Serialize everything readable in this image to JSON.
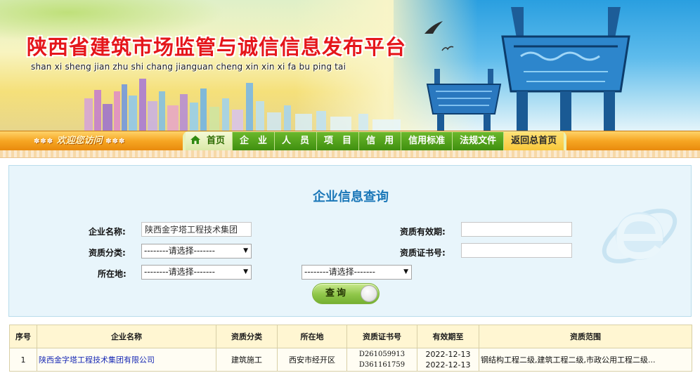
{
  "banner": {
    "title": "陕西省建筑市场监管与诚信信息发布平台",
    "subtitle": "shan xi sheng jian zhu shi chang jianguan cheng xin xin xi fa bu ping tai"
  },
  "nav": {
    "welcome_orn_left": "✽✽✽",
    "welcome": "欢迎您访问",
    "welcome_orn_right": "✽✽✽",
    "items": [
      {
        "label": "首页"
      },
      {
        "label": "企　业"
      },
      {
        "label": "人　员"
      },
      {
        "label": "项　目"
      },
      {
        "label": "信　用"
      },
      {
        "label": "信用标准"
      },
      {
        "label": "法规文件"
      },
      {
        "label": "返回总首页"
      }
    ]
  },
  "query": {
    "title": "企业信息查询",
    "company_name_label": "企业名称:",
    "company_name_value": "陕西金字塔工程技术集团",
    "qual_type_label": "资质分类:",
    "qual_type_value": "--------请选择-------",
    "location_label": "所在地:",
    "location_value_1": "--------请选择-------",
    "location_value_2": "--------请选择-------",
    "validity_label": "资质有效期:",
    "validity_value": "",
    "cert_no_label": "资质证书号:",
    "cert_no_value": "",
    "search_button": "查询"
  },
  "table": {
    "headers": [
      "序号",
      "企业名称",
      "资质分类",
      "所在地",
      "资质证书号",
      "有效期至",
      "资质范围"
    ],
    "rows": [
      {
        "index": "1",
        "name": "陕西金字塔工程技术集团有限公司",
        "category": "建筑施工",
        "location": "西安市经开区",
        "cert_1": "D261059913",
        "cert_2": "D361161759",
        "valid_1": "2022-12-13",
        "valid_2": "2022-12-13",
        "scope": "钢结构工程二级,建筑工程二级,市政公用工程二级..."
      }
    ]
  },
  "colors": {
    "title_red": "#e5161b",
    "nav_green": "#3f8f0f",
    "nav_orange": "#f6a623",
    "panel_bg": "#e8f5fb",
    "panel_title": "#1a77b8",
    "link_blue": "#1a2bb5"
  }
}
